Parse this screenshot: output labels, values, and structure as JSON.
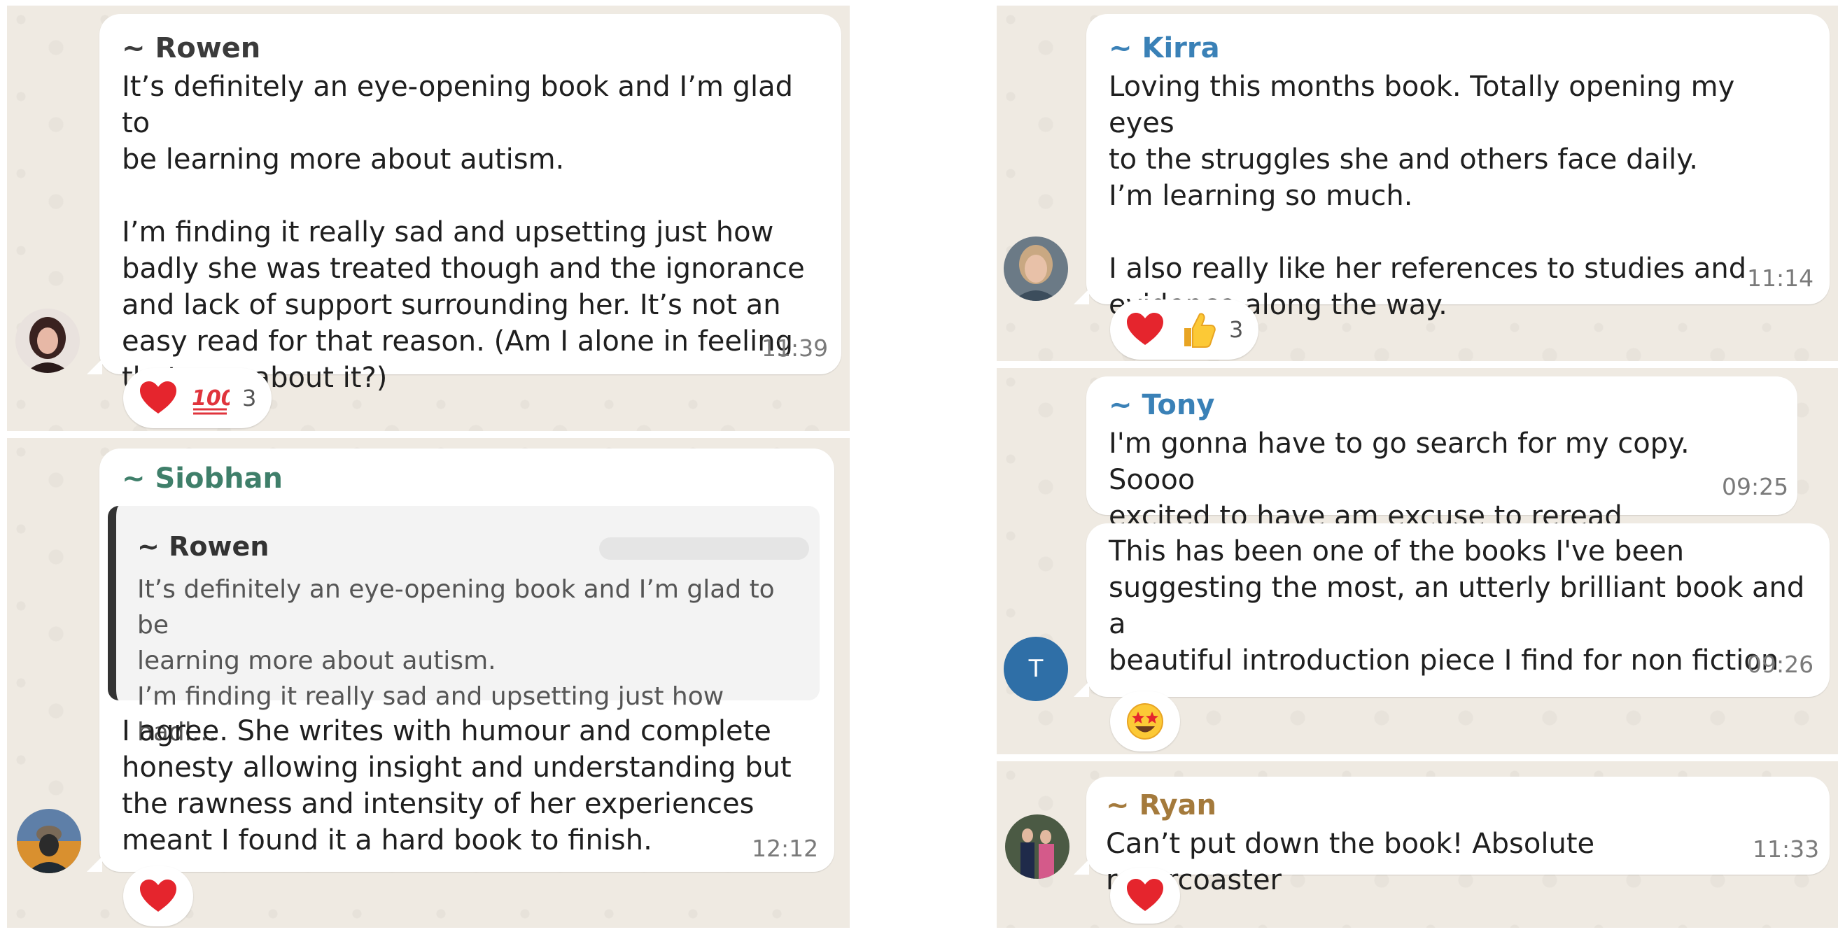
{
  "messages": [
    {
      "sender": "~ Rowen",
      "text": "It’s definitely an eye-opening book and I’m glad to\nbe learning more about autism.\n\nI’m finding it really sad and upsetting just how\nbadly she was treated though and the ignorance\nand lack of support surrounding her. It’s not an\neasy read for that reason. (Am I alone in feeling\nthat way about it?)",
      "time": "11:39",
      "reactions": [
        "heart",
        "100"
      ],
      "reaction_count": "3"
    },
    {
      "sender": "~ Siobhan",
      "quote": {
        "sender": "~ Rowen",
        "text": "It’s definitely an eye-opening book and I’m glad to be\nlearning more about autism.\nI’m finding it really sad and upsetting just how badl…"
      },
      "text": "I agree. She writes with humour and complete\nhonesty allowing insight and understanding but\nthe rawness and intensity of her experiences\nmeant I found it a hard book to finish.",
      "time": "12:12",
      "reactions": [
        "heart"
      ]
    },
    {
      "sender": "~ Kirra",
      "text": "Loving this months book. Totally opening my eyes\nto the struggles she and others face daily.\nI’m learning so much.\n\nI also really like her references to studies and\nevidence along the way.",
      "time": "11:14",
      "reactions": [
        "heart",
        "thumbs-up"
      ],
      "reaction_count": "3"
    },
    {
      "sender": "~ Tony",
      "text": "I'm gonna have to go search for my copy. Soooo\nexcited to have am excuse to reread",
      "time": "09:25",
      "followup": {
        "text": "This has been one of the books I've been\nsuggesting the most, an utterly brilliant book and a\nbeautiful introduction piece I find for non fiction",
        "time": "09:26",
        "reactions": [
          "star-struck"
        ]
      },
      "avatar_letter": "T"
    },
    {
      "sender": "~ Ryan",
      "text": "Can’t put down the book! Absolute rollercoaster",
      "time": "11:33",
      "reactions": [
        "heart"
      ]
    }
  ],
  "colors": {
    "rowen": "#3b3b3b",
    "siobhan": "#3f7f6a",
    "kirra": "#3a81b7",
    "tony": "#3a81b7",
    "ryan": "#a47a3c",
    "chat_bg": "#efeae2",
    "avatar_t": "#2f6fa7"
  }
}
